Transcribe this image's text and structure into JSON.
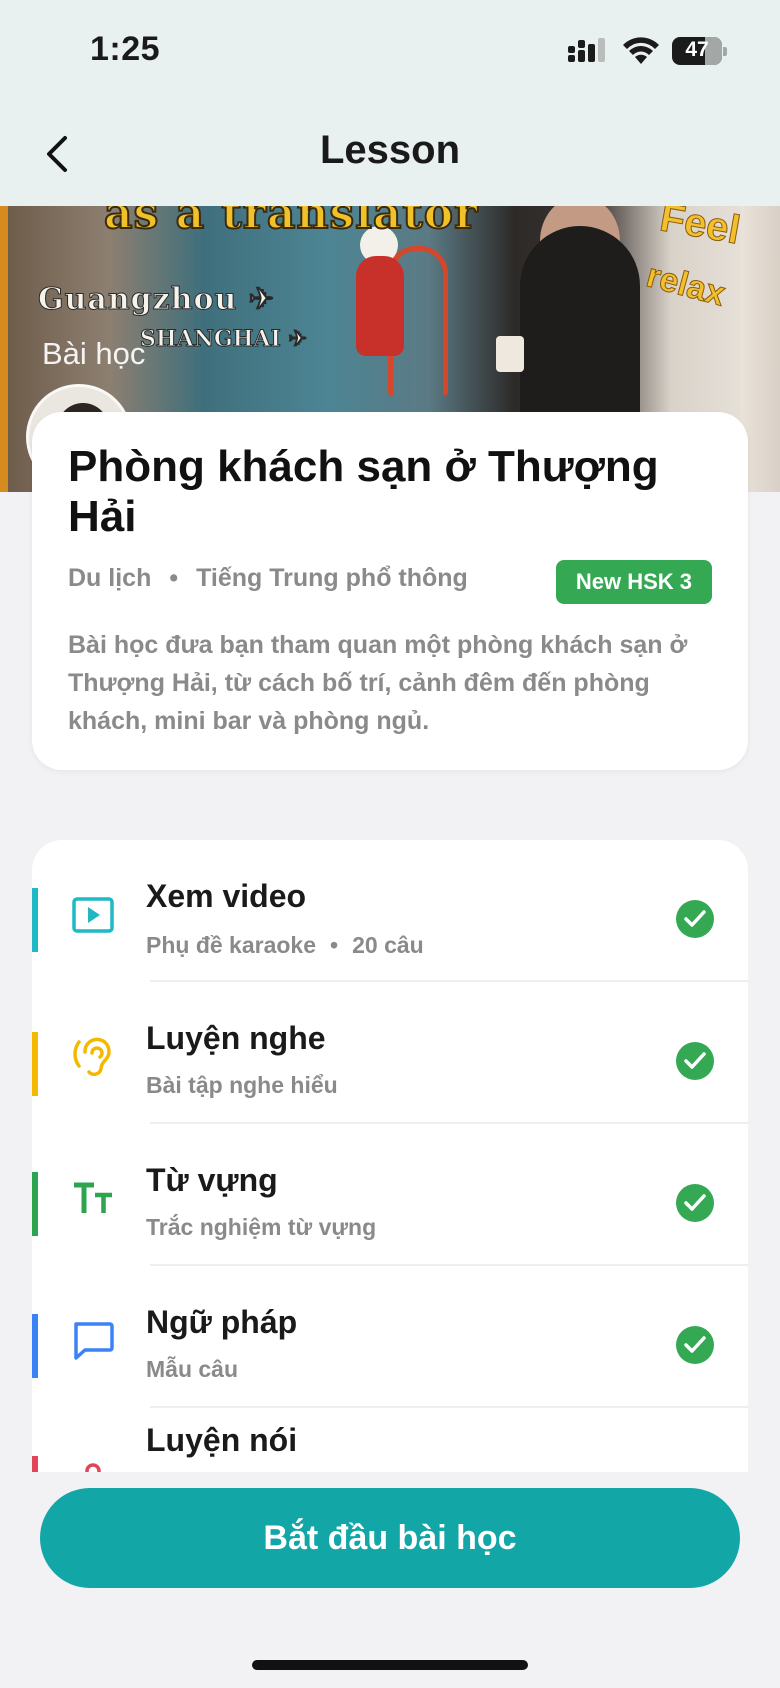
{
  "status_bar": {
    "time": "1:25",
    "battery": "47"
  },
  "nav": {
    "title": "Lesson"
  },
  "hero": {
    "overlay_label": "Bài học",
    "video_title_text": "as a translator",
    "city_1": "Guangzhou ✈",
    "city_2": "SHANGHAI ✈",
    "sticker_1": "Feel",
    "sticker_2": "relax"
  },
  "lesson": {
    "title": "Phòng khách sạn ở Thượng Hải",
    "category": "Du lịch",
    "language": "Tiếng Trung phổ thông",
    "level": "New HSK 3",
    "description": "Bài học đưa bạn tham quan một phòng khách sạn ở Thượng Hải, từ cách bố trí, cảnh đêm đến phòng khách, mini bar và phòng ngủ."
  },
  "steps": [
    {
      "name": "Xem video",
      "sub_1": "Phụ đề karaoke",
      "sub_sep": "•",
      "sub_2": "20 câu",
      "icon": "play-video-icon",
      "color": "#1fb8c3",
      "completed": true
    },
    {
      "name": "Luyện nghe",
      "sub_1": "Bài tập nghe hiểu",
      "icon": "ear-icon",
      "color": "#f5b800",
      "completed": true
    },
    {
      "name": "Từ vựng",
      "sub_1": "Trắc nghiệm từ vựng",
      "icon": "text-size-icon",
      "color": "#2ea44f",
      "completed": true
    },
    {
      "name": "Ngữ pháp",
      "sub_1": "Mẫu câu",
      "icon": "chat-bubble-icon",
      "color": "#3b82f6",
      "completed": true
    },
    {
      "name": "Luyện nói",
      "icon": "microphone-icon",
      "color": "#e0455a",
      "completed": false
    }
  ],
  "footer": {
    "start_label": "Bắt đầu bài học"
  }
}
